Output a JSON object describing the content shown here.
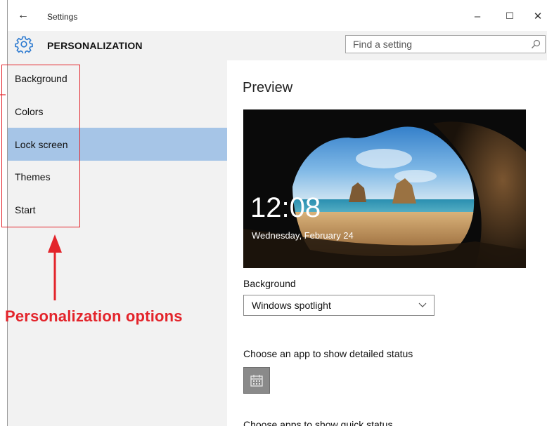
{
  "window": {
    "app_title": "Settings",
    "back_glyph": "←",
    "minimize_glyph": "–",
    "maximize_glyph": "☐",
    "close_glyph": "✕"
  },
  "header": {
    "title": "PERSONALIZATION",
    "icon": "gear-icon",
    "search_placeholder": "Find a setting",
    "search_icon": "search-icon"
  },
  "sidebar": {
    "items": [
      {
        "label": "Background",
        "selected": false
      },
      {
        "label": "Colors",
        "selected": false
      },
      {
        "label": "Lock screen",
        "selected": true
      },
      {
        "label": "Themes",
        "selected": false
      },
      {
        "label": "Start",
        "selected": false
      }
    ]
  },
  "annotation": {
    "text": "Personalization options",
    "color": "#e3242b"
  },
  "content": {
    "preview_title": "Preview",
    "preview_time": "12:08",
    "preview_date": "Wednesday, February 24",
    "background_label": "Background",
    "background_value": "Windows spotlight",
    "detailed_status_label": "Choose an app to show detailed status",
    "detailed_status_icon": "calendar-icon",
    "quick_status_label": "Choose apps to show quick status"
  },
  "colors": {
    "selected_item": "#a6c5e7",
    "sidebar_bg": "#f2f2f2",
    "accent_icon": "#2b79d0"
  }
}
